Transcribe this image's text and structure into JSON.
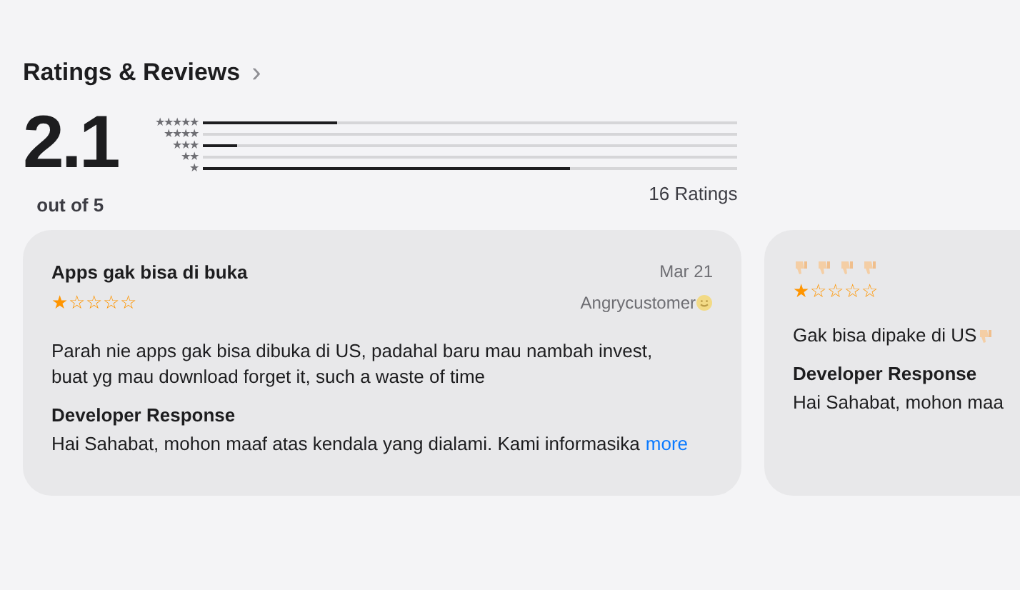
{
  "section": {
    "title": "Ratings & Reviews",
    "chevron": "›"
  },
  "summary": {
    "average": "2.1",
    "out_of": "out of 5",
    "total": "16 Ratings"
  },
  "histogram": [
    {
      "label": "★★★★★",
      "level": 0.25
    },
    {
      "label": "★★★★",
      "level": 0
    },
    {
      "label": "★★★",
      "level": 0.0625
    },
    {
      "label": "★★",
      "level": 0
    },
    {
      "label": "★",
      "level": 0.6875
    }
  ],
  "reviews": [
    {
      "kind": "text-title",
      "title": "Apps gak bisa di buka",
      "stars": 1,
      "date": "Mar 21",
      "author": "Angrycustomer",
      "body": "Parah nie apps gak bisa dibuka di US, padahal baru mau nambah invest, buat yg mau download forget it, such a waste of time",
      "response_title": "Developer Response",
      "response": "Hai Sahabat, mohon maaf atas kendala yang dialami. Kami informasika",
      "more": "more"
    },
    {
      "kind": "emoji-title",
      "stars": 1,
      "body": "Gak bisa dipake di US",
      "response_title": "Developer Response",
      "response": "Hai Sahabat, mohon maa"
    }
  ]
}
